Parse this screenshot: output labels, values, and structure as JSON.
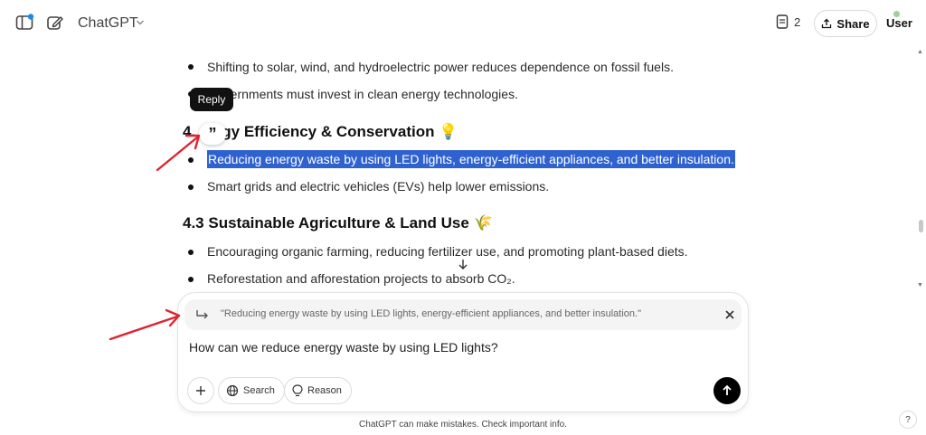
{
  "header": {
    "brand": "ChatGPT",
    "doc_count": "2",
    "share_label": "Share",
    "user_label": "User"
  },
  "content": {
    "bullets_top": [
      "Shifting to solar, wind, and hydroelectric power reduces dependence on fossil fuels.",
      "Governments must invest in clean energy technologies."
    ],
    "heading_42_prefix": "4.",
    "heading_42_rest": "ergy Efficiency & Conservation",
    "heading_42_emoji": "💡",
    "bullets_42": [
      "Reducing energy waste by using LED lights, energy-efficient appliances, and better insulation.",
      "Smart grids and electric vehicles (EVs) help lower emissions."
    ],
    "heading_43": "4.3 Sustainable Agriculture & Land Use",
    "heading_43_emoji": "🌾",
    "bullets_43": [
      "Encouraging organic farming, reducing fertilizer use, and promoting plant-based diets.",
      "Reforestation and afforestation projects to absorb CO₂."
    ]
  },
  "tooltip": {
    "reply_label": "Reply"
  },
  "composer": {
    "quoted_text": "\"Reducing energy waste by using LED lights, energy-efficient appliances, and better insulation.\"",
    "input_value": "How can we reduce energy waste by using LED lights?",
    "search_label": "Search",
    "reason_label": "Reason"
  },
  "footer": {
    "disclaimer": "ChatGPT can make mistakes. Check important info.",
    "help_label": "?"
  },
  "colors": {
    "highlight": "#2f62d1",
    "annotation_arrow": "#e0242e",
    "notification_dot": "#1e88e5"
  }
}
